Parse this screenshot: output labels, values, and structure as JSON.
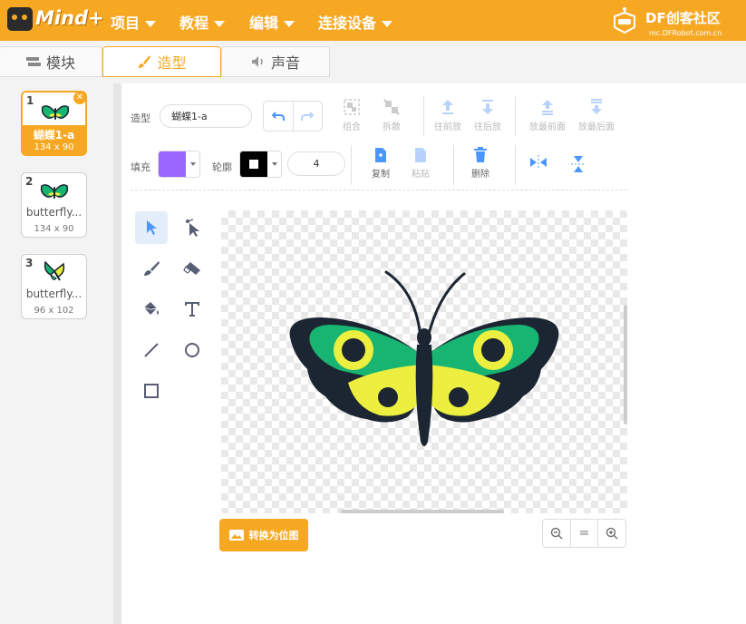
{
  "app": {
    "logo_text": "Mind+"
  },
  "menu": [
    {
      "label": "项目"
    },
    {
      "label": "教程"
    },
    {
      "label": "编辑"
    },
    {
      "label": "连接设备"
    }
  ],
  "brand": {
    "title": "DF创客社区",
    "subtitle": "mc.DFRobot.com.cn"
  },
  "tabs": [
    {
      "label": "模块",
      "icon": "blocks-icon"
    },
    {
      "label": "造型",
      "icon": "brush-icon",
      "active": true
    },
    {
      "label": "声音",
      "icon": "speaker-icon"
    }
  ],
  "costumes": [
    {
      "index": "1",
      "name": "蝴蝶1-a",
      "size": "134 x 90",
      "selected": true
    },
    {
      "index": "2",
      "name": "butterfly...",
      "size": "134 x 90"
    },
    {
      "index": "3",
      "name": "butterfly...",
      "size": "96 x 102"
    }
  ],
  "toolbar": {
    "costume_label": "造型",
    "costume_name": "蝴蝶1-a",
    "group": "组合",
    "ungroup": "拆散",
    "forward": "往前放",
    "backward": "往后放",
    "front": "放最前面",
    "back": "放最后面",
    "fill_label": "填充",
    "outline_label": "轮廓",
    "outline_width": "4",
    "copy": "复制",
    "paste": "粘贴",
    "delete": "删除"
  },
  "colors": {
    "accent": "#f7a823",
    "fill": "#9966ff",
    "outline": "#000000",
    "wing_green": "#18b472",
    "wing_yellow": "#ecef3f",
    "body": "#1c2532"
  },
  "tools": [
    "select-icon",
    "reshape-icon",
    "brush-icon",
    "eraser-icon",
    "fill-icon",
    "text-icon",
    "line-icon",
    "circle-icon",
    "rectangle-icon"
  ],
  "convert_button": "转换为位图",
  "zoom": {
    "zoom_out": "-",
    "reset": "=",
    "zoom_in": "+"
  }
}
